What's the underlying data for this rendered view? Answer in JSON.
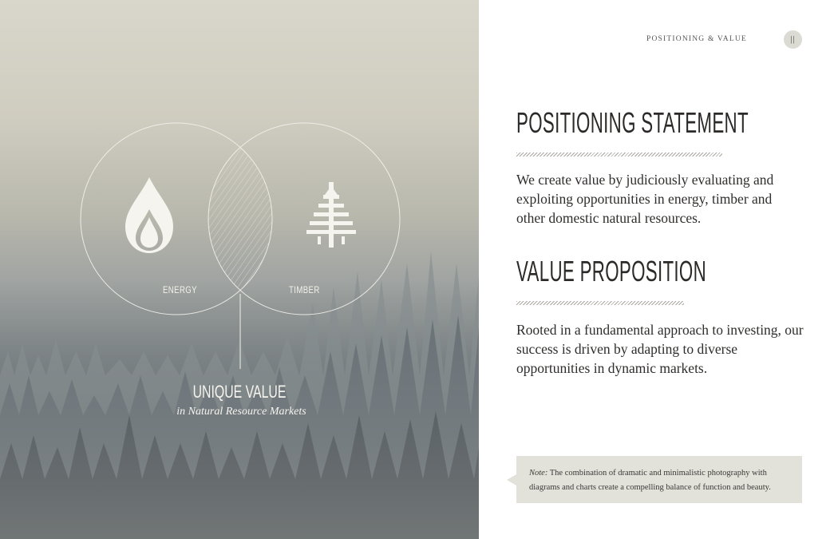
{
  "header": {
    "section_label": "Positioning & Value",
    "page_number": "||"
  },
  "diagram": {
    "left_circle_label": "ENERGY",
    "right_circle_label": "TIMBER",
    "intersection_title": "UNIQUE VALUE",
    "intersection_subtitle": "in Natural Resource Markets",
    "left_icon": "flame-icon",
    "right_icon": "tree-icon"
  },
  "positioning": {
    "heading": "POSITIONING STATEMENT",
    "body": "We create value by judiciously evaluating and exploiting opportunities in energy, timber and other domestic natural resources."
  },
  "value": {
    "heading": "VALUE PROPOSITION",
    "body": "Rooted in a fundamental approach to investing, our success is driven by adapting to diverse opportunities in dynamic markets."
  },
  "note": {
    "label": "Note:",
    "text": "The combination of dramatic and minimalistic photography with diagrams and charts create a compelling balance of function and beauty."
  },
  "colors": {
    "photo_light": "#d9d7cb",
    "photo_dark": "#3a434a",
    "text_dark": "#2b2a28",
    "note_bg": "#e2e1da"
  }
}
